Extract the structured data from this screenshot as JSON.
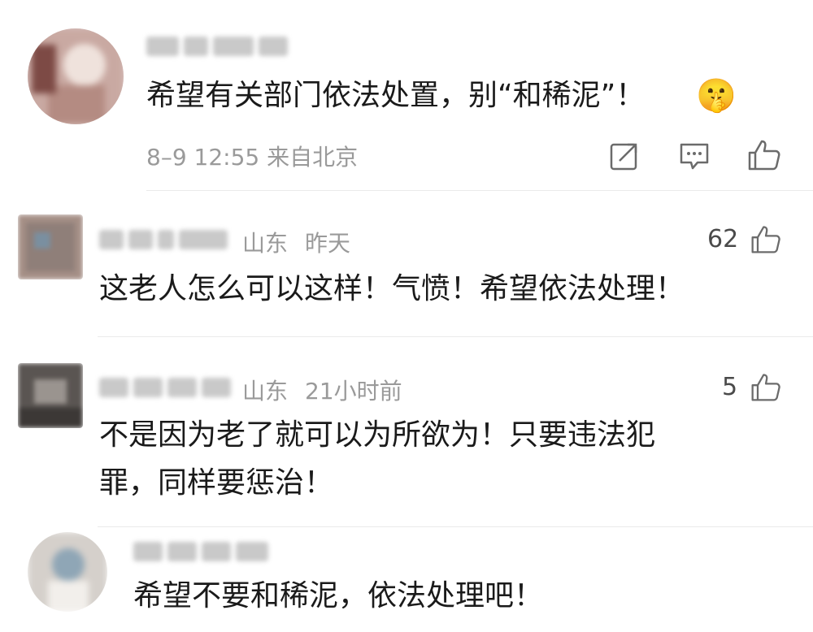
{
  "comments": [
    {
      "text": "希望有关部门依法处置，别“和稀泥”！",
      "emoji": "🤫",
      "meta": "8–9 12:55 来自北京"
    },
    {
      "location": "山东",
      "time": "昨天",
      "likes": "62",
      "text": "这老人怎么可以这样！气愤！希望依法处理！"
    },
    {
      "location": "山东",
      "time": "21小时前",
      "likes": "5",
      "text_line1": "不是因为老了就可以为所欲为！只要违法犯",
      "text_line2": "罪，同样要惩治！"
    },
    {
      "text": "希望不要和稀泥，依法处理吧！"
    }
  ],
  "colors": {
    "text": "#1a1a1a",
    "meta": "#9a9a9a",
    "divider": "#eaeaea",
    "icon": "#6b6b6b"
  }
}
